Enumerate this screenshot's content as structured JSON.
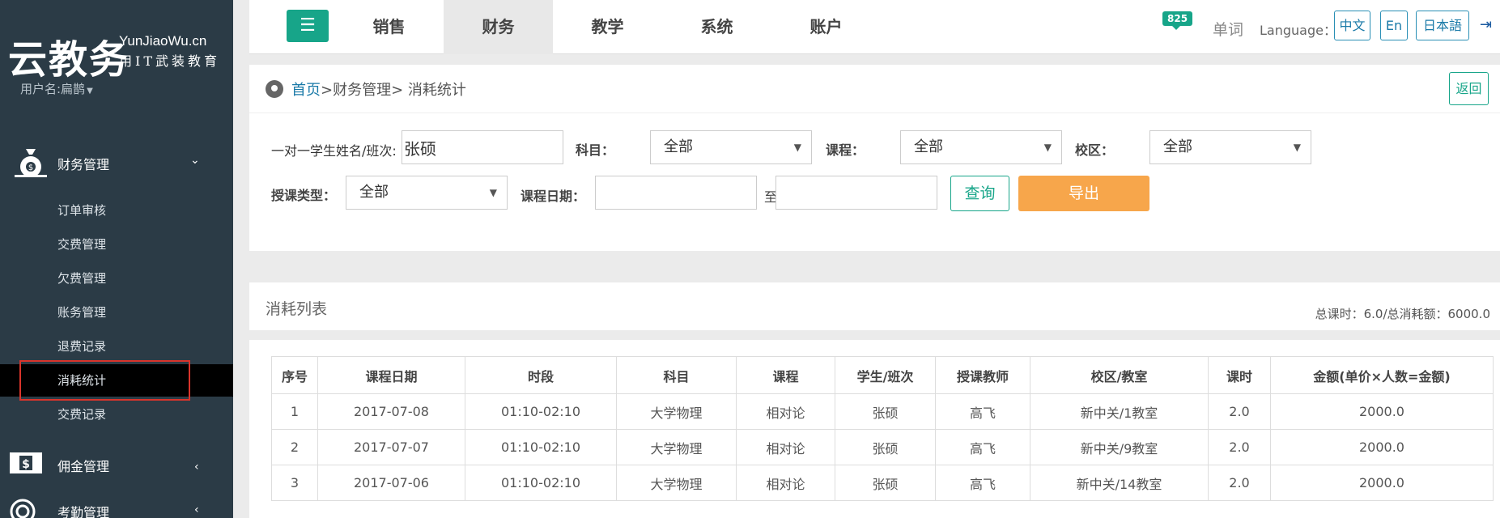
{
  "sidebar": {
    "logo_cn": "云教务",
    "logo_en": "YunJiaoWu.cn",
    "logo_slogan": "用IT武装教育",
    "username": "用户名:扁鹊",
    "finance_menu": "财务管理",
    "finance_items": [
      "订单审核",
      "交费管理",
      "欠费管理",
      "账务管理",
      "退费记录",
      "消耗统计",
      "交费记录"
    ],
    "commission_menu": "佣金管理",
    "attendance_menu": "考勤管理"
  },
  "topnav": {
    "tabs": [
      "销售",
      "财务",
      "教学",
      "系统",
      "账户"
    ],
    "active_tab": "财务",
    "badge": "825",
    "word": "单词",
    "language_label": "Language：",
    "languages": [
      "中文",
      "En",
      "日本語"
    ]
  },
  "breadcrumb": {
    "home": "首页",
    "path": ">财务管理> 消耗统计",
    "back": "返回"
  },
  "filters": {
    "student_label": "一对一学生姓名/班次:",
    "student_value": "张硕",
    "subject_label": "科目：",
    "subject_value": "全部",
    "course_label": "课程：",
    "course_value": "全部",
    "campus_label": "校区：",
    "campus_value": "全部",
    "type_label": "授课类型：",
    "type_value": "全部",
    "date_label": "课程日期：",
    "date_to": "至",
    "query": "查询",
    "export": "导出"
  },
  "list": {
    "title": "消耗列表",
    "summary": "总课时：6.0/总消耗额：6000.0",
    "headers": [
      "序号",
      "课程日期",
      "时段",
      "科目",
      "课程",
      "学生/班次",
      "授课教师",
      "校区/教室",
      "课时",
      "金额(单价×人数=金额)"
    ],
    "rows": [
      [
        "1",
        "2017-07-08",
        "01:10-02:10",
        "大学物理",
        "相对论",
        "张硕",
        "高飞",
        "新中关/1教室",
        "2.0",
        "2000.0"
      ],
      [
        "2",
        "2017-07-07",
        "01:10-02:10",
        "大学物理",
        "相对论",
        "张硕",
        "高飞",
        "新中关/9教室",
        "2.0",
        "2000.0"
      ],
      [
        "3",
        "2017-07-06",
        "01:10-02:10",
        "大学物理",
        "相对论",
        "张硕",
        "高飞",
        "新中关/14教室",
        "2.0",
        "2000.0"
      ]
    ]
  }
}
